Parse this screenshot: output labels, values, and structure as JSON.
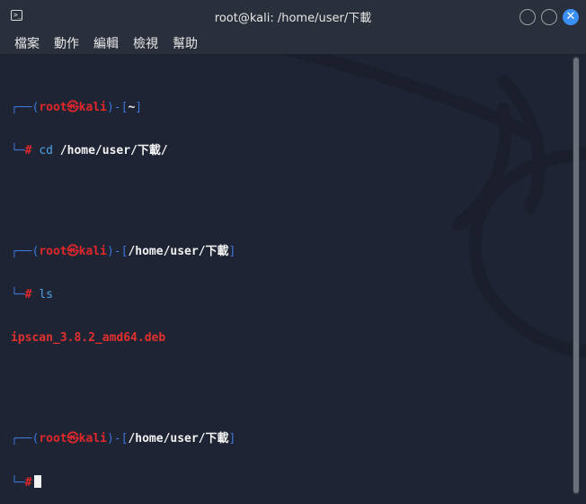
{
  "window": {
    "title": "root@kali: /home/user/下載",
    "app_icon_glyph": ">_"
  },
  "menu": [
    {
      "label": "檔案"
    },
    {
      "label": "動作"
    },
    {
      "label": "編輯"
    },
    {
      "label": "檢視"
    },
    {
      "label": "幫助"
    }
  ],
  "terminal": {
    "prompt_open": "┌──(",
    "user": "root",
    "at": "㉿",
    "host": "kali",
    "bracket_mid": ")-[",
    "bracket_close": "]",
    "prompt_hash_prefix": "└─",
    "hash": "#",
    "blocks": [
      {
        "path": "~",
        "command": "cd",
        "args": "/home/user/下載/",
        "output": ""
      },
      {
        "path": "/home/user/下載",
        "command": "ls",
        "args": "",
        "output": "ipscan_3.8.2_amd64.deb"
      },
      {
        "path": "/home/user/下載",
        "command": "",
        "args": "",
        "output": ""
      }
    ]
  },
  "colors": {
    "background": "#1e2433",
    "prompt_blue": "#3a77d8",
    "prompt_red": "#e0282b",
    "command_blue": "#4ea2e8"
  }
}
